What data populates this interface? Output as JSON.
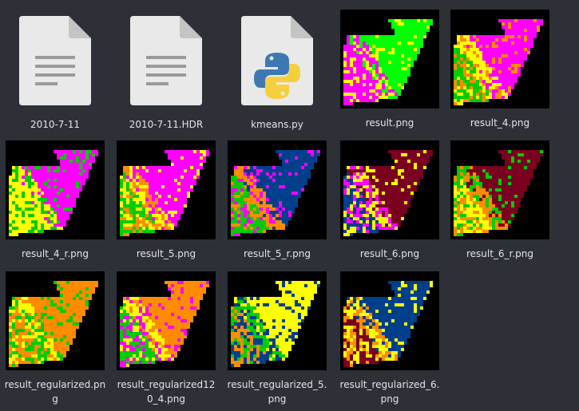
{
  "files": [
    {
      "name": "2010-7-11",
      "type": "document",
      "icon": "document-icon"
    },
    {
      "name": "2010-7-11.HDR",
      "type": "document",
      "icon": "document-icon"
    },
    {
      "name": "kmeans.py",
      "type": "python",
      "icon": "python-file-icon"
    },
    {
      "name": "result.png",
      "type": "image",
      "colors": {
        "a": "#00ff00",
        "b": "#ff00ff",
        "c": "#ffff00",
        "d": "#ff00ff"
      }
    },
    {
      "name": "result_4.png",
      "type": "image",
      "colors": {
        "a": "#ff00ff",
        "b": "#ffff00",
        "c": "#ff8c00",
        "d": "#00cc00"
      }
    },
    {
      "name": "result_4_r.png",
      "type": "image",
      "colors": {
        "a": "#ff00ff",
        "b": "#ffff00",
        "c": "#00cc00",
        "d": "#ffff00"
      }
    },
    {
      "name": "result_5.png",
      "type": "image",
      "colors": {
        "a": "#ff00ff",
        "b": "#ff8c00",
        "c": "#ffff00",
        "d": "#00cc00"
      }
    },
    {
      "name": "result_5_r.png",
      "type": "image",
      "colors": {
        "a": "#003f8c",
        "b": "#ff8c00",
        "c": "#ff00ff",
        "d": "#00cc00"
      }
    },
    {
      "name": "result_6.png",
      "type": "image",
      "colors": {
        "a": "#7a0020",
        "b": "#ff00ff",
        "c": "#ffff00",
        "d": "#003f8c"
      }
    },
    {
      "name": "result_6_r.png",
      "type": "image",
      "colors": {
        "a": "#7a0020",
        "b": "#ff8c00",
        "c": "#00cc00",
        "d": "#ffff00"
      }
    },
    {
      "name": "result_regularized.png",
      "type": "image",
      "colors": {
        "a": "#ff8c00",
        "b": "#ffff00",
        "c": "#00cc00",
        "d": "#ff8c00"
      }
    },
    {
      "name": "result_regularized120_4.png",
      "type": "image",
      "colors": {
        "a": "#ff8c00",
        "b": "#ffff00",
        "c": "#ff00ff",
        "d": "#00cc00"
      }
    },
    {
      "name": "result_regularized_5.png",
      "type": "image",
      "colors": {
        "a": "#ffff00",
        "b": "#00cc00",
        "c": "#003f8c",
        "d": "#ff8c00"
      }
    },
    {
      "name": "result_regularized_6.png",
      "type": "image",
      "colors": {
        "a": "#003f8c",
        "b": "#ff8c00",
        "c": "#ffff00",
        "d": "#7a0020"
      }
    }
  ]
}
